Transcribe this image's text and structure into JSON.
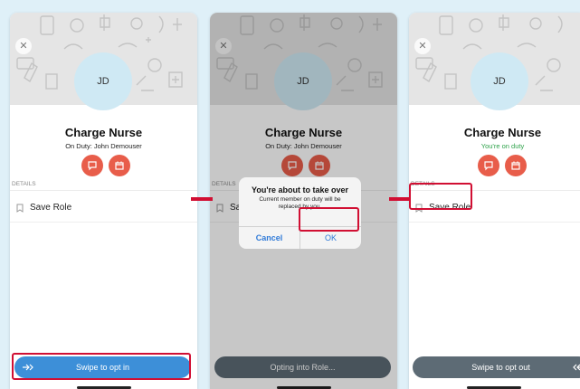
{
  "colors": {
    "background": "#dff0f8",
    "avatar_bg": "#cfe9f4",
    "action_red": "#e85d4a",
    "swipe_blue": "#3d8fd8",
    "swipe_gray": "#5d6b75",
    "on_duty_green": "#2ea24a",
    "highlight_red": "#d10f33",
    "dialog_link": "#2f7ad8"
  },
  "panels": [
    {
      "avatar_initials": "JD",
      "role_title": "Charge Nurse",
      "duty_status": "On Duty: John Demouser",
      "details_label": "DETAILS",
      "save_role_label": "Save Role",
      "swipe_label": "Swipe to opt in",
      "swipe_icon": "double-arrow-right-icon"
    },
    {
      "avatar_initials": "JD",
      "role_title": "Charge Nurse",
      "duty_status": "On Duty: John Demouser",
      "details_label": "DETAILS",
      "save_role_label": "Sav",
      "swipe_label": "Opting into Role...",
      "dialog": {
        "title": "You're about to take over",
        "message": "Current member on duty will be replaced by you.",
        "cancel_label": "Cancel",
        "ok_label": "OK"
      }
    },
    {
      "avatar_initials": "JD",
      "role_title": "Charge Nurse",
      "duty_status": "You're on duty",
      "details_label": "DETAILS",
      "save_role_label": "Save Role",
      "swipe_label": "Swipe to opt out",
      "swipe_icon": "double-arrow-left-icon"
    }
  ]
}
